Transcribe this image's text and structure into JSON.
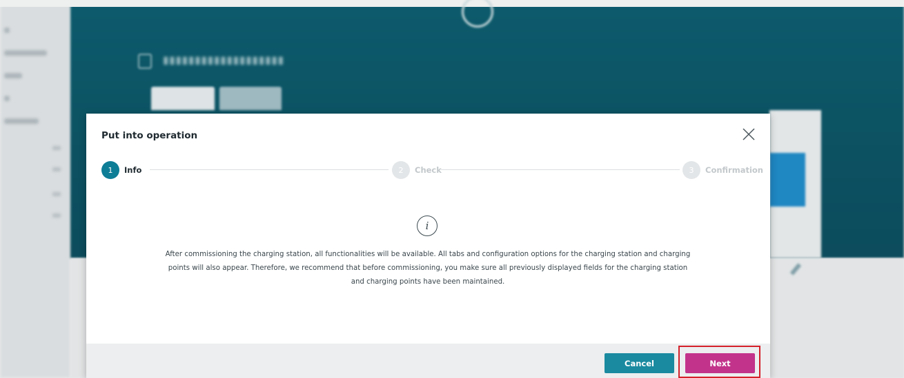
{
  "modal": {
    "title": "Put into operation",
    "steps": [
      {
        "number": "1",
        "label": "Info",
        "state": "active"
      },
      {
        "number": "2",
        "label": "Check",
        "state": "inactive"
      },
      {
        "number": "3",
        "label": "Confirmation",
        "state": "inactive"
      }
    ],
    "info_icon_glyph": "i",
    "body_text": "After commissioning the charging station, all functionalities will be available. All tabs and configuration options for the charging station and charging points will also appear. Therefore, we recommend that before commissioning, you make sure all previously displayed fields for the charging station and charging points have been maintained.",
    "cancel_label": "Cancel",
    "next_label": "Next"
  },
  "colors": {
    "header_teal": "#0b5f72",
    "step_active": "#0e7d96",
    "cancel_button": "#1a8aa0",
    "next_button": "#c2338b",
    "highlight_box": "#d4202a"
  },
  "icons": [
    "close-icon",
    "info-icon",
    "charging-station-icon",
    "pencil-icon",
    "logo-icon"
  ]
}
